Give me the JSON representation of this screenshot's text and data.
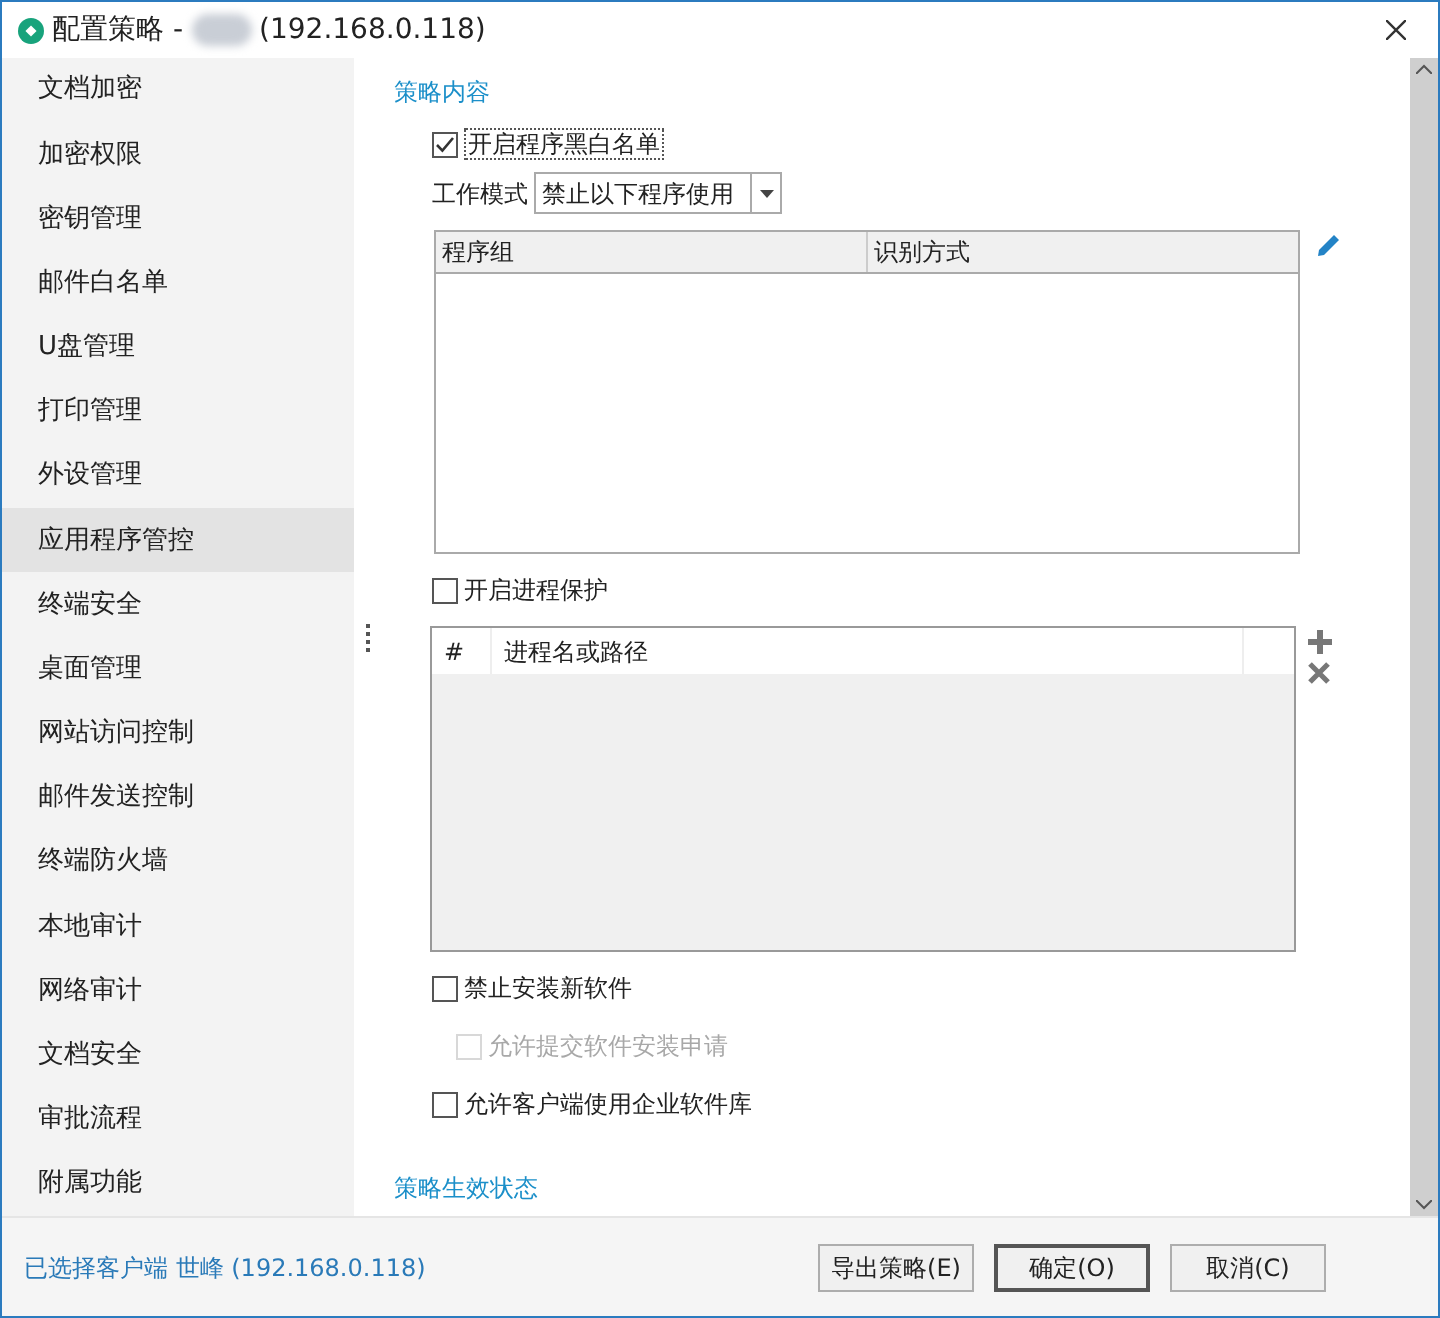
{
  "window": {
    "title_prefix": "配置策略 -",
    "title_suffix": "(192.168.0.118)"
  },
  "sidebar": {
    "items": [
      {
        "label": "文档加密",
        "selected": false
      },
      {
        "label": "加密权限",
        "selected": false
      },
      {
        "label": "密钥管理",
        "selected": false
      },
      {
        "label": "邮件白名单",
        "selected": false
      },
      {
        "label": "U盘管理",
        "selected": false
      },
      {
        "label": "打印管理",
        "selected": false
      },
      {
        "label": "外设管理",
        "selected": false
      },
      {
        "label": "应用程序管控",
        "selected": true
      },
      {
        "label": "终端安全",
        "selected": false
      },
      {
        "label": "桌面管理",
        "selected": false
      },
      {
        "label": "网站访问控制",
        "selected": false
      },
      {
        "label": "邮件发送控制",
        "selected": false
      },
      {
        "label": "终端防火墙",
        "selected": false
      },
      {
        "label": "本地审计",
        "selected": false
      },
      {
        "label": "网络审计",
        "selected": false
      },
      {
        "label": "文档安全",
        "selected": false
      },
      {
        "label": "审批流程",
        "selected": false
      },
      {
        "label": "附属功能",
        "selected": false
      }
    ]
  },
  "content": {
    "section_title": "策略内容",
    "whitelist": {
      "label": "开启程序黑白名单",
      "checked": true
    },
    "work_mode": {
      "label": "工作模式",
      "value": "禁止以下程序使用"
    },
    "program_table": {
      "columns": [
        "程序组",
        "识别方式"
      ]
    },
    "process_protect": {
      "label": "开启进程保护",
      "checked": false
    },
    "process_table": {
      "columns": [
        "#",
        "进程名或路径"
      ]
    },
    "options": [
      {
        "label": "禁止安装新软件",
        "checked": false,
        "disabled": false,
        "indent": false
      },
      {
        "label": "允许提交软件安装申请",
        "checked": false,
        "disabled": true,
        "indent": true
      },
      {
        "label": "允许客户端使用企业软件库",
        "checked": false,
        "disabled": false,
        "indent": false
      }
    ],
    "status_title": "策略生效状态"
  },
  "footer": {
    "client": "已选择客户端 世峰 (192.168.0.118)",
    "buttons": [
      "导出策略(E)",
      "确定(O)",
      "取消(C)"
    ]
  }
}
